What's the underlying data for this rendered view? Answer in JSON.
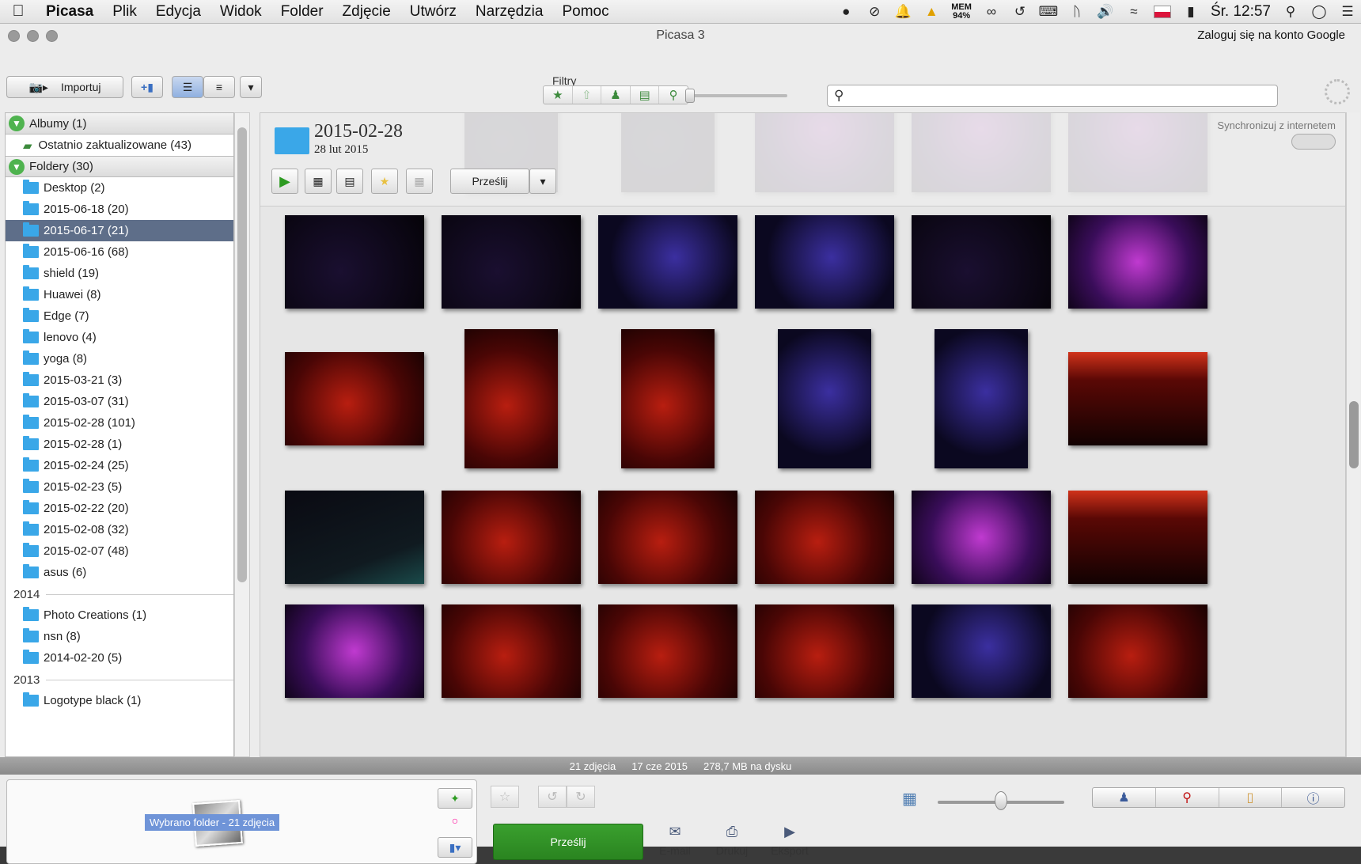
{
  "menubar": {
    "apple": "",
    "items": [
      "Picasa",
      "Plik",
      "Edycja",
      "Widok",
      "Folder",
      "Zdjęcie",
      "Utwórz",
      "Narzędzia",
      "Pomoc"
    ],
    "mem_label": "MEM",
    "mem_value": "94%",
    "clock": "Śr. 12:57"
  },
  "window": {
    "title": "Picasa 3",
    "login": "Zaloguj się na konto Google"
  },
  "toolbar": {
    "import_label": "Importuj",
    "filters_label": "Filtry",
    "search_placeholder": ""
  },
  "sidebar": {
    "albums_header": "Albumy (1)",
    "albums": [
      "Ostatnio zaktualizowane (43)"
    ],
    "folders_header": "Foldery (30)",
    "folders": [
      "Desktop (2)",
      "2015-06-18 (20)",
      "2015-06-17 (21)",
      "2015-06-16 (68)",
      "shield (19)",
      "Huawei (8)",
      "Edge (7)",
      "lenovo (4)",
      "yoga (8)",
      "2015-03-21 (3)",
      "2015-03-07 (31)",
      "2015-02-28 (101)",
      "2015-02-28 (1)",
      "2015-02-24 (25)",
      "2015-02-23 (5)",
      "2015-02-22 (20)",
      "2015-02-08 (32)",
      "2015-02-07 (48)",
      "asus (6)"
    ],
    "selected_index": 2,
    "year_2014": "2014",
    "folders_2014": [
      "Photo Creations (1)",
      "nsn (8)",
      "2014-02-20 (5)"
    ],
    "year_2013": "2013",
    "folders_2013": [
      "Logotype black (1)"
    ]
  },
  "folder_header": {
    "title": "2015-02-28",
    "date": "28 lut 2015",
    "sync_label": "Synchronizuj z internetem",
    "share_label": "Prześlij"
  },
  "status": {
    "count": "21 zdjęcia",
    "date": "17 cze 2015",
    "size": "278,7 MB na dysku"
  },
  "tray": {
    "label": "Wybrano folder - 21 zdjęcia"
  },
  "actions": {
    "share": "Prześlij",
    "email": "E-mail",
    "print": "Drukuj",
    "export": "Eksport"
  },
  "colors": {
    "accent_green": "#2e8b22",
    "selection": "#5e6e89",
    "folder_blue": "#3aa7e8"
  }
}
